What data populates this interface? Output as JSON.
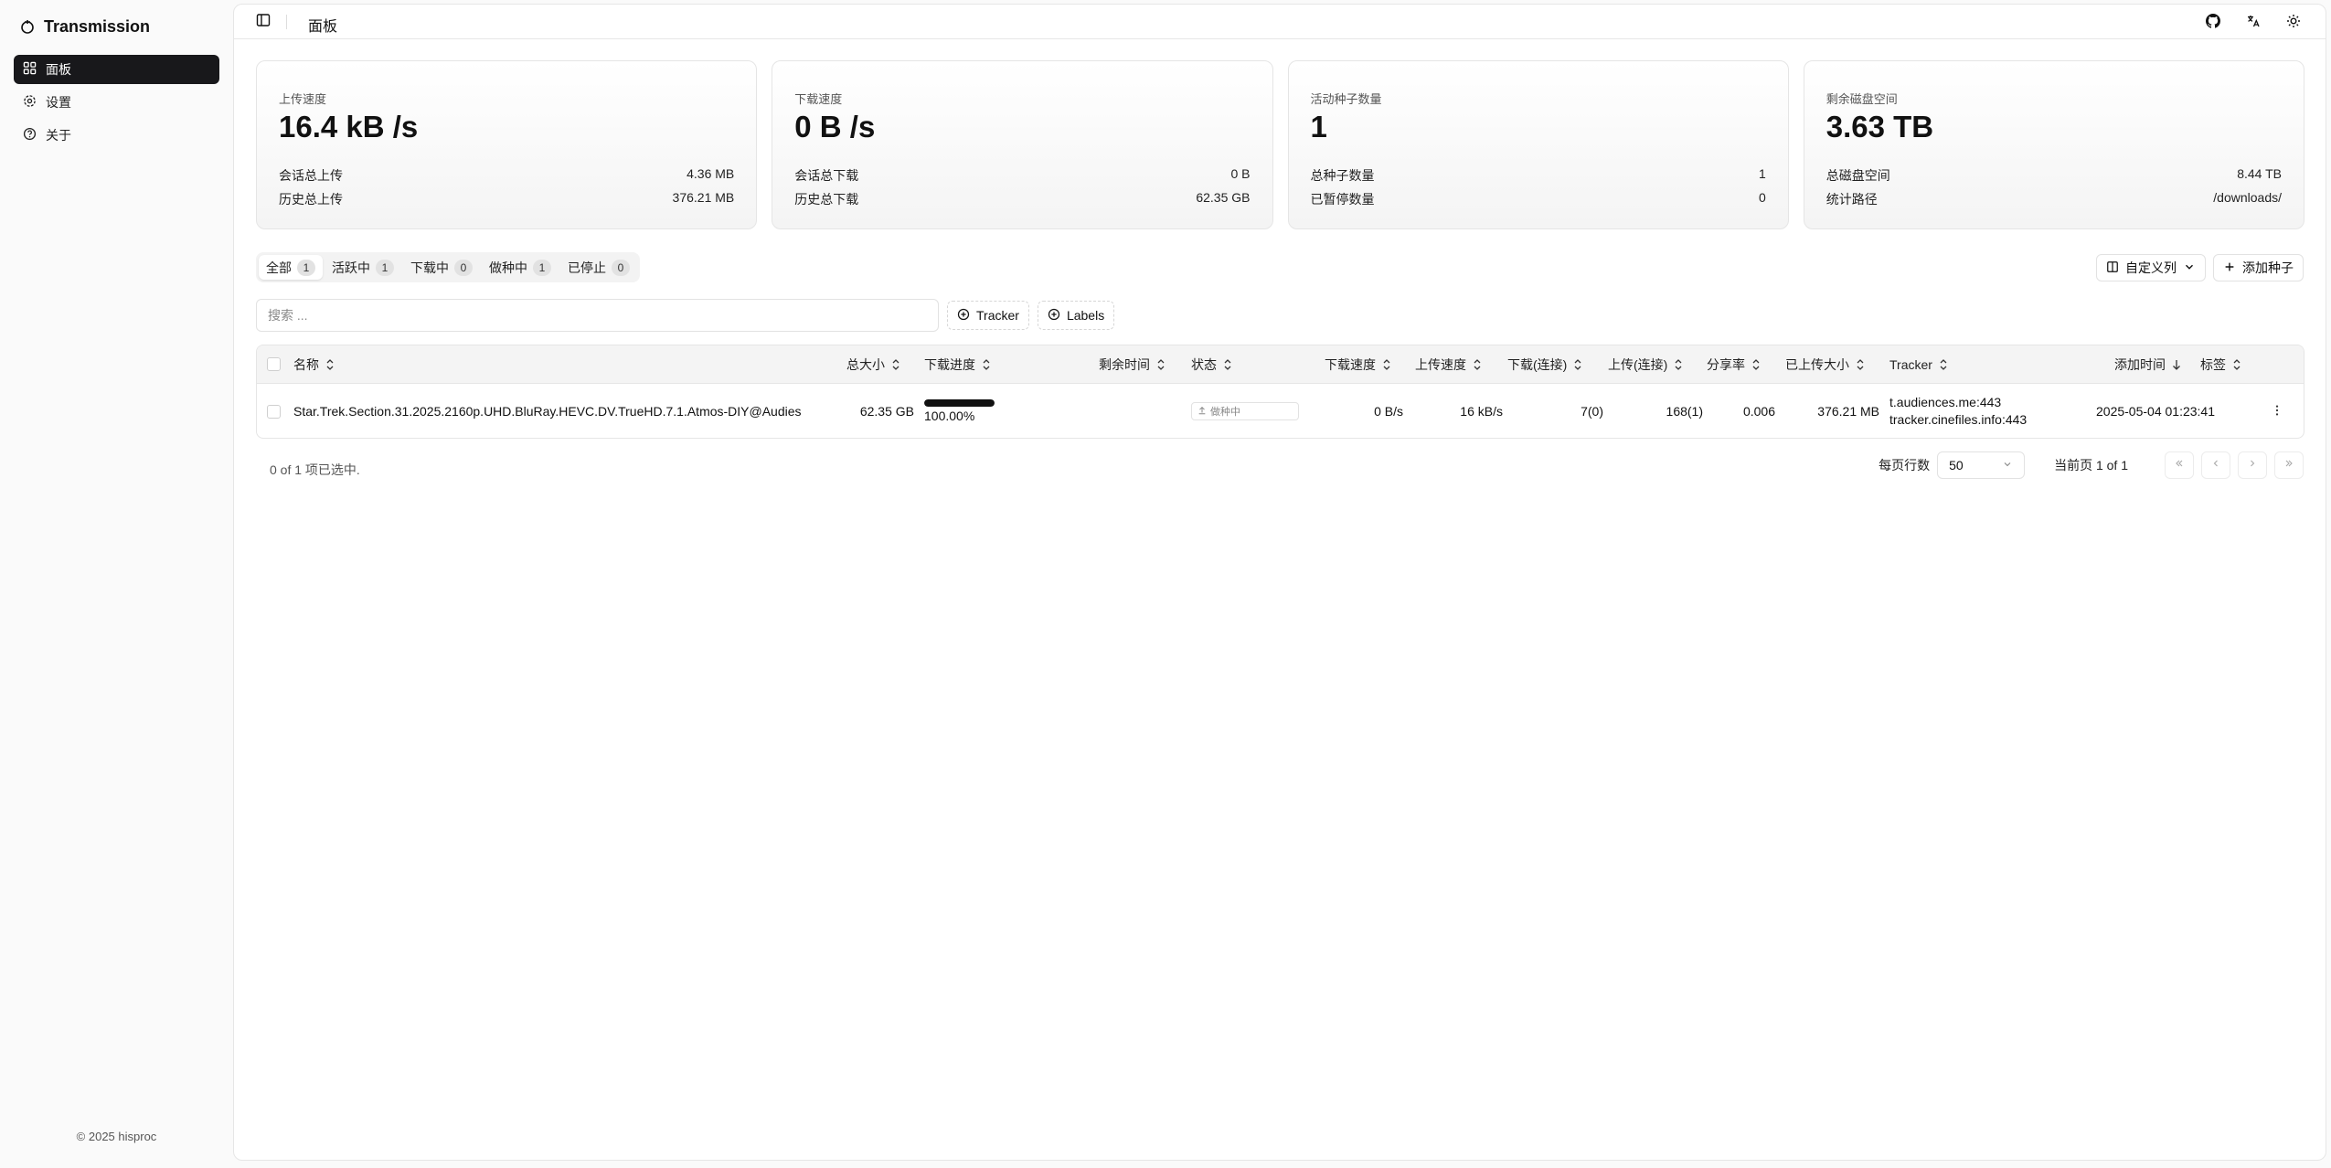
{
  "app": {
    "title": "Transmission"
  },
  "sidebar": {
    "items": [
      {
        "label": "面板"
      },
      {
        "label": "设置"
      },
      {
        "label": "关于"
      }
    ],
    "copyright": "© 2025 hisproc"
  },
  "topbar": {
    "page_title": "面板"
  },
  "stats": [
    {
      "label": "上传速度",
      "value": "16.4 kB /s",
      "row1_label": "会话总上传",
      "row1_value": "4.36 MB",
      "row2_label": "历史总上传",
      "row2_value": "376.21 MB"
    },
    {
      "label": "下载速度",
      "value": "0 B /s",
      "row1_label": "会话总下载",
      "row1_value": "0 B",
      "row2_label": "历史总下载",
      "row2_value": "62.35 GB"
    },
    {
      "label": "活动种子数量",
      "value": "1",
      "row1_label": "总种子数量",
      "row1_value": "1",
      "row2_label": "已暂停数量",
      "row2_value": "0"
    },
    {
      "label": "剩余磁盘空间",
      "value": "3.63 TB",
      "row1_label": "总磁盘空间",
      "row1_value": "8.44 TB",
      "row2_label": "统计路径",
      "row2_value": "/downloads/"
    }
  ],
  "tabs": [
    {
      "label": "全部",
      "count": "1"
    },
    {
      "label": "活跃中",
      "count": "1"
    },
    {
      "label": "下载中",
      "count": "0"
    },
    {
      "label": "做种中",
      "count": "1"
    },
    {
      "label": "已停止",
      "count": "0"
    }
  ],
  "actions": {
    "columns": "自定义列",
    "add": "添加种子"
  },
  "search": {
    "placeholder": "搜索 ..."
  },
  "filters": {
    "tracker": "Tracker",
    "labels": "Labels"
  },
  "table": {
    "headers": {
      "name": "名称",
      "size": "总大小",
      "progress": "下载进度",
      "eta": "剩余时间",
      "status": "状态",
      "dl_speed": "下载速度",
      "ul_speed": "上传速度",
      "dl_peers": "下载(连接)",
      "ul_peers": "上传(连接)",
      "ratio": "分享率",
      "uploaded": "已上传大小",
      "tracker": "Tracker",
      "added": "添加时间",
      "labels": "标签"
    },
    "rows": [
      {
        "name": "Star.Trek.Section.31.2025.2160p.UHD.BluRay.HEVC.DV.TrueHD.7.1.Atmos-DIY@Audies",
        "size": "62.35 GB",
        "progress": "100.00%",
        "progress_fraction": 1.0,
        "eta": "",
        "status": "做种中",
        "dl_speed": "0 B/s",
        "ul_speed": "16 kB/s",
        "dl_peers": "7(0)",
        "ul_peers": "168(1)",
        "ratio": "0.006",
        "uploaded": "376.21 MB",
        "tracker1": "t.audiences.me:443",
        "tracker2": "tracker.cinefiles.info:443",
        "added": "2025-05-04 01:23:41"
      }
    ]
  },
  "footer": {
    "selected": "0 of 1 项已选中.",
    "rows_per_page_label": "每页行数",
    "rows_per_page": "50",
    "page_info": "当前页 1 of 1"
  }
}
